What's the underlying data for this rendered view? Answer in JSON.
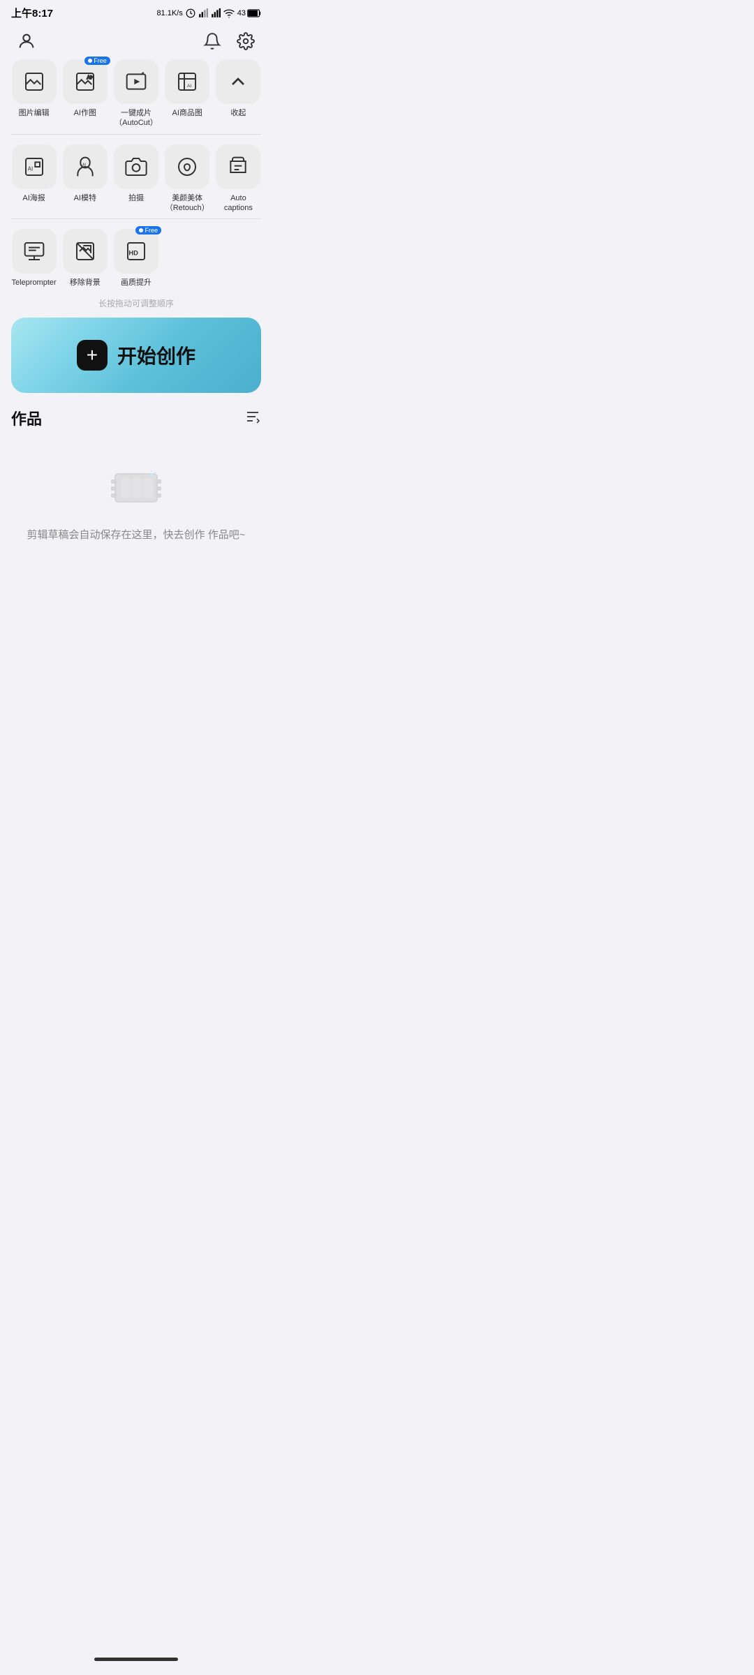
{
  "status": {
    "time": "上午8:17",
    "speed": "81.1K/s",
    "battery": "43"
  },
  "nav": {
    "profile_icon": "person",
    "bell_icon": "bell",
    "settings_icon": "gear"
  },
  "tools": {
    "rows": [
      [
        {
          "id": "image-edit",
          "label": "图片编辑",
          "free": false
        },
        {
          "id": "ai-draw",
          "label": "AI作图",
          "free": true
        },
        {
          "id": "autocut",
          "label": "一键成片\n（AutoCut）",
          "free": false
        },
        {
          "id": "ai-product",
          "label": "AI商品图",
          "free": false
        },
        {
          "id": "collapse",
          "label": "收起",
          "free": false
        }
      ],
      [
        {
          "id": "ai-poster",
          "label": "AI海报",
          "free": false
        },
        {
          "id": "ai-model",
          "label": "AI模特",
          "free": false
        },
        {
          "id": "camera",
          "label": "拍摄",
          "free": false
        },
        {
          "id": "retouch",
          "label": "美颜美体\n（Retouch）",
          "free": false
        },
        {
          "id": "auto-captions",
          "label": "Auto captions",
          "free": false
        }
      ],
      [
        {
          "id": "teleprompter",
          "label": "Teleprompter",
          "free": false
        },
        {
          "id": "remove-bg",
          "label": "移除背景",
          "free": false
        },
        {
          "id": "hd-enhance",
          "label": "画质提升",
          "free": true
        }
      ]
    ],
    "hint": "长按拖动可调整顺序"
  },
  "create_button": {
    "plus": "+",
    "label": "开始创作"
  },
  "works": {
    "title": "作品",
    "empty_text": "剪辑草稿会自动保存在这里，快去创作\n作品吧~"
  },
  "bottom": {
    "home_indicator": ""
  }
}
